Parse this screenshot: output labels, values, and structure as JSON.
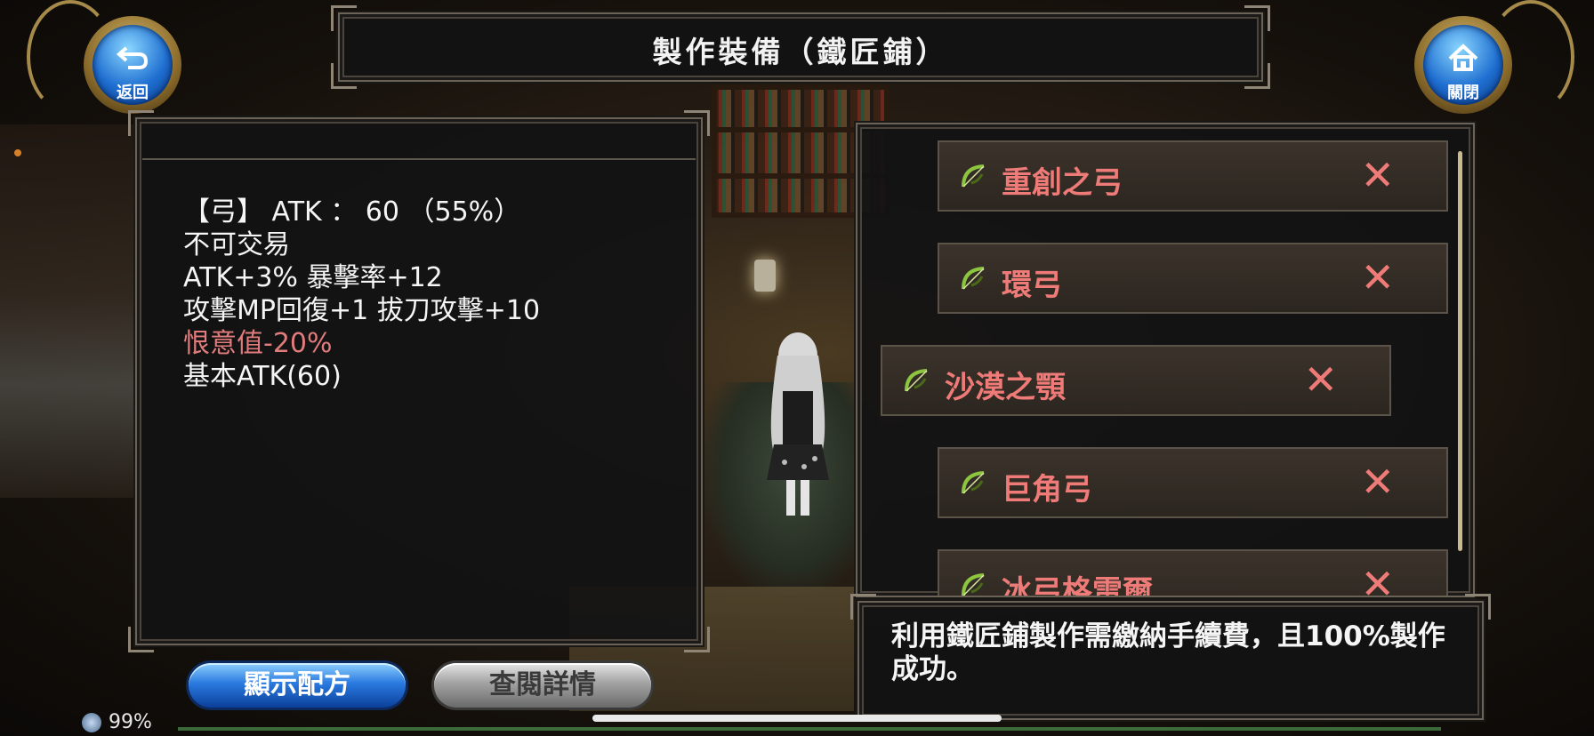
{
  "header": {
    "title": "製作裝備（鐵匠鋪）",
    "back_label": "返回",
    "close_label": "關閉"
  },
  "detail": {
    "lines": [
      "【弓】 ATK ： 60 （55%）",
      "不可交易",
      "ATK+3% 暴擊率+12",
      "攻擊MP回復+1 拔刀攻擊+10",
      "恨意值-20%",
      "基本ATK(60)"
    ]
  },
  "recipes": {
    "items": [
      {
        "name": "重創之弓",
        "remove": "✕"
      },
      {
        "name": "環弓",
        "remove": "✕"
      },
      {
        "name": "沙漠之顎",
        "remove": "✕"
      },
      {
        "name": "巨角弓",
        "remove": "✕"
      },
      {
        "name": "冰弓格雷爾",
        "remove": "✕"
      }
    ]
  },
  "message": {
    "text": "利用鐵匠鋪製作需繳納手續費，且100%製作成功。"
  },
  "buttons": {
    "show_recipe": "顯示配方",
    "view_details": "查閱詳情"
  },
  "status": {
    "battery": "99%"
  },
  "colors": {
    "item_text": "#ef7b79",
    "accent_blue": "#2a7ae0"
  }
}
